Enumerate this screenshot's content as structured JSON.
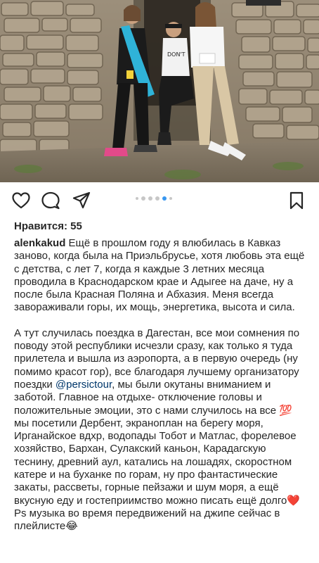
{
  "post": {
    "likes_label": "Нравится: 55",
    "username": "alenkakud",
    "paragraph1": " Ещё в прошлом году я влюбилась в Кавказ заново, когда была на Приэльбрусье, хотя любовь эта ещё с детства, с лет 7, когда я каждые 3 летних месяца проводила в Краснодарском крае и Адыгее на даче, ну а после была Красная Поляна и Абхазия. Меня всегда завораживали горы, их мощь, энергетика, высота и сила.",
    "paragraph2_before_mention": "А тут случилась поездка в Дагестан, все мои сомнения по поводу этой республики исчезли сразу, как только я туда прилетела и вышла из аэропорта, а в первую очередь (ну помимо красот гор), все благодаря лучшему организатору поездки ",
    "mention": "@persictour",
    "paragraph2_after_mention": ", мы были окутаны вниманием и заботой. Главное на отдыхе- отключение головы и положительные эмоции, это с нами случилось на все 💯 мы посетили Дербент, экраноплан на берегу моря, Ирганайское вдхр, водопады Тобот и Матлас, форелевое хозяйство, Бархан, Сулакский каньон, Карадагскую теснину, древний аул, катались на лошадях, скоростном катере и на буханке по горам, ну про фантастические закаты, рассветы, горные пейзажи и шум моря, а ещё вкусную еду и гостеприимство можно писать ещё долго❤️",
    "paragraph3": "Ps музыка во время передвижений на джипе сейчас в плейлисте😂"
  },
  "carousel": {
    "count": 6,
    "active_index": 4
  },
  "icons": {
    "like": "heart-icon",
    "comment": "comment-bubble-icon",
    "share": "paper-plane-icon",
    "save": "bookmark-icon"
  },
  "colors": {
    "text": "#262626",
    "mention": "#00376b",
    "active_dot": "#3897f0",
    "inactive_dot": "#c7c7c7"
  }
}
